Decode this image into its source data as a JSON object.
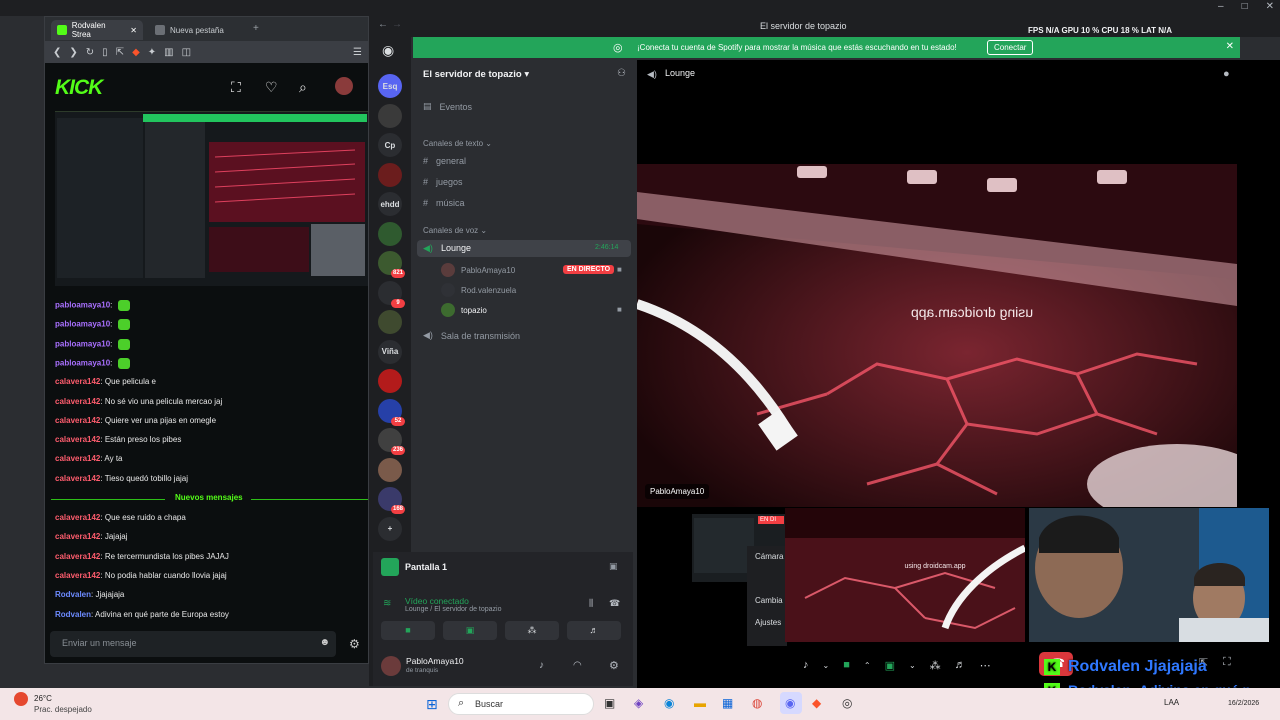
{
  "browser": {
    "tabs": [
      {
        "label": "Rodvalen Strea"
      },
      {
        "label": "Nueva pestaña"
      }
    ],
    "kick_logo": "KICK",
    "chat_messages": [
      {
        "user": "pabloamaya10",
        "text": "",
        "color": "#a970ff",
        "emote": true
      },
      {
        "user": "pabloamaya10",
        "text": "",
        "color": "#a970ff",
        "emote": true
      },
      {
        "user": "pabloamaya10",
        "text": "",
        "color": "#a970ff",
        "emote": true
      },
      {
        "user": "pabloamaya10",
        "text": "",
        "color": "#a970ff",
        "emote": true
      },
      {
        "user": "calavera142",
        "text": "Que pelicula e",
        "color": "#ff5d6e"
      },
      {
        "user": "calavera142",
        "text": "No sé vio una pelicula mercao jaj",
        "color": "#ff5d6e"
      },
      {
        "user": "calavera142",
        "text": "Quiere ver una pijas en omegle",
        "color": "#ff5d6e"
      },
      {
        "user": "calavera142",
        "text": "Están preso los pibes",
        "color": "#ff5d6e"
      },
      {
        "user": "calavera142",
        "text": "Ay ta",
        "color": "#ff5d6e"
      },
      {
        "user": "calavera142",
        "text": "Tieso quedó tobillo jajaj",
        "color": "#ff5d6e"
      }
    ],
    "new_messages_label": "Nuevos mensajes",
    "new_chat_messages": [
      {
        "user": "calavera142",
        "text": "Que ese ruido a chapa",
        "color": "#ff5d6e"
      },
      {
        "user": "calavera142",
        "text": "Jajajaj",
        "color": "#ff5d6e"
      },
      {
        "user": "calavera142",
        "text": "Re tercermundista los pibes JAJAJ",
        "color": "#ff5d6e"
      },
      {
        "user": "calavera142",
        "text": "No podia hablar cuando llovia jajaj",
        "color": "#ff5d6e"
      },
      {
        "user": "Rodvalen",
        "text": "Jjajajaja",
        "color": "#6d8bff"
      },
      {
        "user": "Rodvalen",
        "text": "Adivina en qué parte de Europa estoy",
        "color": "#6d8bff"
      }
    ],
    "chat_placeholder": "Enviar un mensaje"
  },
  "discord": {
    "window_title": "El servidor de topazio",
    "spotify_banner": "¡Conecta tu cuenta de Spotify para mostrar la música que estás escuchando en tu estado!",
    "spotify_button": "Conectar",
    "stats": "FPS N/A   GPU 10 %   CPU 18 %   LAT N/A",
    "servers": [
      {
        "label": "Esq",
        "badge": ""
      },
      {
        "label": "",
        "badge": ""
      },
      {
        "label": "Cp",
        "badge": ""
      },
      {
        "label": "",
        "badge": ""
      },
      {
        "label": "ehdd",
        "badge": ""
      },
      {
        "label": "",
        "badge": ""
      },
      {
        "label": "",
        "badge": "821"
      },
      {
        "label": "",
        "badge": "9"
      },
      {
        "label": "",
        "badge": ""
      },
      {
        "label": "Viña",
        "badge": ""
      },
      {
        "label": "",
        "badge": ""
      },
      {
        "label": "",
        "badge": "52"
      },
      {
        "label": "",
        "badge": "236"
      },
      {
        "label": "",
        "badge": ""
      },
      {
        "label": "",
        "badge": "168"
      },
      {
        "label": "+",
        "badge": ""
      }
    ],
    "server_name": "El servidor de topazio",
    "events_label": "Eventos",
    "text_category": "Canales de texto",
    "text_channels": [
      "general",
      "juegos",
      "música"
    ],
    "voice_category": "Canales de voz",
    "voice_channel": "Lounge",
    "voice_timer": "2:46:14",
    "voice_users": [
      "PabloAmaya10",
      "Rod.valenzuela",
      "topazio"
    ],
    "live_badge": "EN DIRECTO",
    "stage_channel": "Sala de transmisión",
    "screen_panel": {
      "title": "Pantalla 1",
      "status": "Vídeo conectado",
      "sub": "Lounge / El servidor de topazio"
    },
    "user_panel": {
      "name": "PabloAmaya10",
      "status": "de tranquis"
    },
    "stage_header": "Lounge",
    "cam_watermark": "using droidcam.app",
    "cam_user": "PabloAmaya10",
    "thumb_labels": [
      "Cámara",
      "Cambia",
      "Ajustes",
      "EN DI"
    ],
    "thumb_watermark": "using droidcam.app"
  },
  "taskbar": {
    "weather_temp": "26°C",
    "weather_desc": "Prac. despejado",
    "search_placeholder": "Buscar",
    "lang": "LAA",
    "date": "16/2/2026"
  },
  "overlay": {
    "line1": "Rodvalen  Jjajajaja",
    "line2": "Rodvalen: Adivina en qué p"
  }
}
